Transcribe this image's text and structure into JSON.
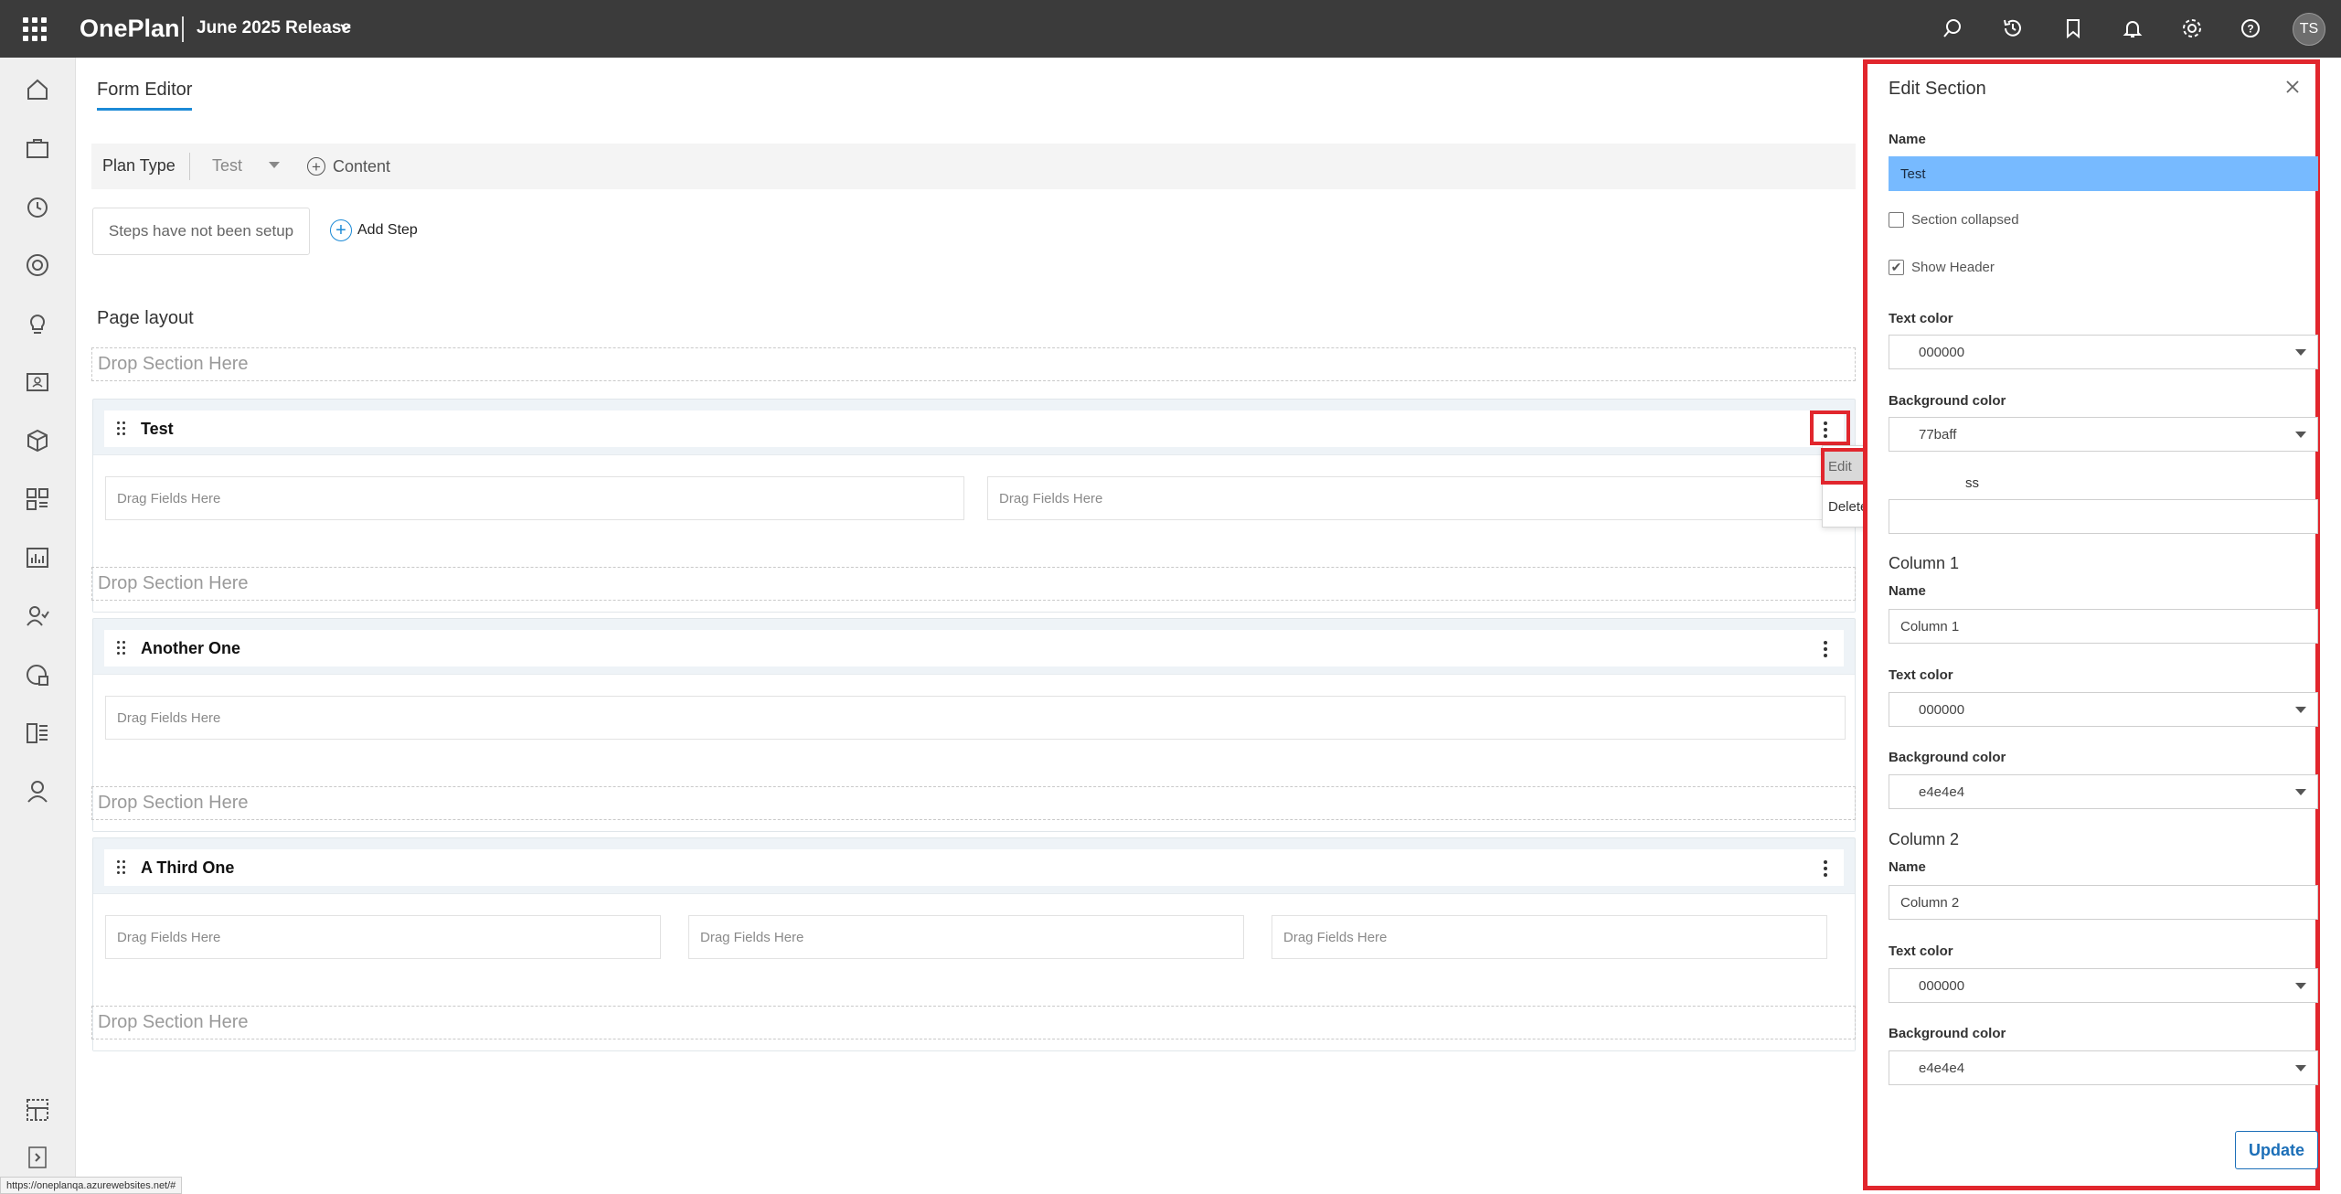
{
  "header": {
    "app_name": "OnePlan",
    "release_label": "June 2025 Release",
    "avatar_initials": "TS",
    "icons": [
      "search-icon",
      "history-icon",
      "bookmark-icon",
      "bell-icon",
      "gear-icon",
      "help-icon"
    ]
  },
  "leftnav": {
    "icons": [
      "home-icon",
      "briefcase-icon",
      "timer-icon",
      "target-icon",
      "lightbulb-icon",
      "id-card-icon",
      "package-icon",
      "dashboard-icon",
      "chart-icon",
      "people-icon",
      "analytics-icon",
      "board-icon",
      "person-icon",
      "layout-icon",
      "expand-icon"
    ]
  },
  "main": {
    "tab_label": "Form Editor",
    "toolbar": {
      "plan_type_label": "Plan Type",
      "plan_type_value": "Test",
      "content_label": "Content"
    },
    "steps_placeholder": "Steps have not been setup",
    "add_step_label": "Add Step",
    "page_layout_title": "Page layout",
    "drop_section_label": "Drop Section Here",
    "drag_fields_label": "Drag Fields Here",
    "sections": [
      {
        "title": "Test",
        "columns": 2
      },
      {
        "title": "Another One",
        "columns": 1
      },
      {
        "title": "A Third One",
        "columns": 3
      }
    ],
    "context_menu": {
      "edit_label": "Edit",
      "delete_label": "Delete"
    }
  },
  "panel": {
    "title": "Edit Section",
    "name_label": "Name",
    "name_value": "Test",
    "section_collapsed_label": "Section collapsed",
    "section_collapsed_checked": false,
    "show_header_label": "Show Header",
    "show_header_checked": true,
    "text_color_label": "Text color",
    "text_color_value": "000000",
    "background_color_label": "Background color",
    "background_color_value": "77baff",
    "css_label_visible": "ss",
    "column1": {
      "title": "Column 1",
      "name_label": "Name",
      "name_value": "Column 1",
      "text_color_label": "Text color",
      "text_color_value": "000000",
      "background_color_label": "Background color",
      "background_color_value": "e4e4e4"
    },
    "column2": {
      "title": "Column 2",
      "name_label": "Name",
      "name_value": "Column 2",
      "text_color_label": "Text color",
      "text_color_value": "000000",
      "background_color_label": "Background color",
      "background_color_value": "e4e4e4"
    },
    "update_label": "Update"
  },
  "status_bar": {
    "url": "https://oneplanqa.azurewebsites.net/#"
  },
  "colors": {
    "topbar": "#3b3b3b",
    "accent": "#1c8ad6",
    "highlight": "#e1262d",
    "name_selection": "#77baff"
  }
}
